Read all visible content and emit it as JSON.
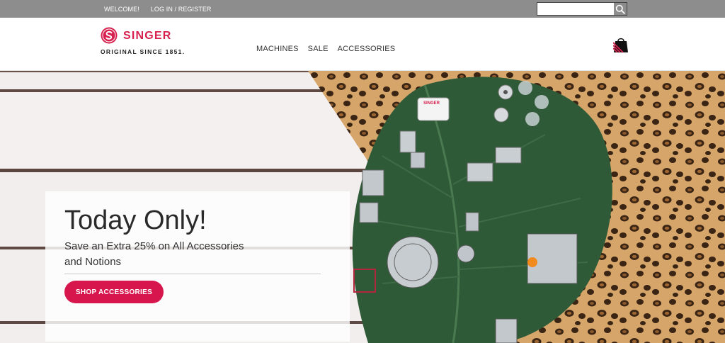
{
  "topbar": {
    "welcome": "WELCOME!",
    "login": "LOG IN / REGISTER",
    "search_placeholder": "",
    "search_icon": "magnifier-icon"
  },
  "header": {
    "brand": "SINGER",
    "tagline": "ORIGINAL SINCE 1851.",
    "nav": [
      "MACHINES",
      "SALE",
      "ACCESSORIES"
    ],
    "cart_icon": "shopping-bag-icon"
  },
  "hero": {
    "title": "Today Only!",
    "subtitle": "Save an Extra 25% on All Accessories and Notions",
    "cta": "SHOP ACCESSORIES"
  },
  "colors": {
    "brand": "#d6204e",
    "cta": "#d6164d",
    "topbar": "#8d8d8d",
    "leaf": "#2f5a37",
    "leopard": "#c08a4e"
  }
}
